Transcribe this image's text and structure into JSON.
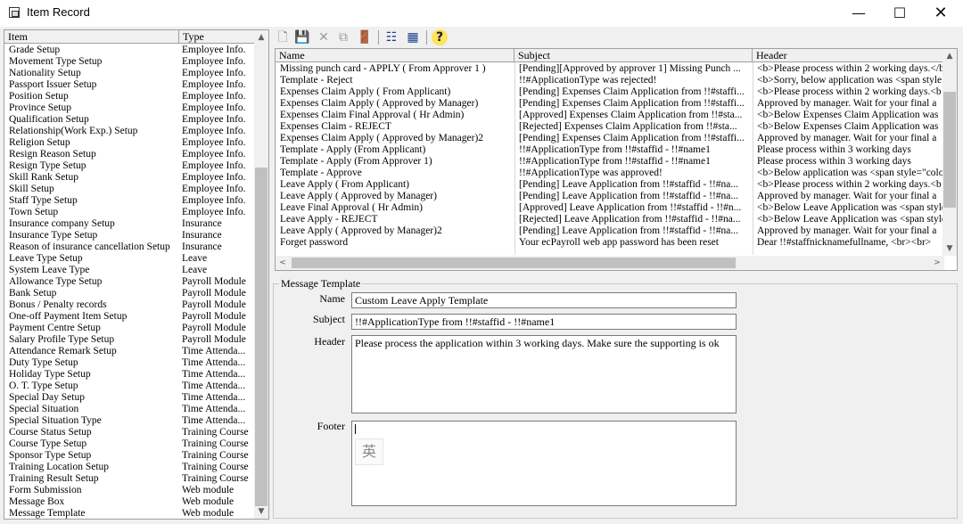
{
  "window": {
    "title": "Item Record",
    "minimize_glyph": "—",
    "maximize_glyph": "☐",
    "close_glyph": "✕"
  },
  "left_list": {
    "columns": [
      "Item",
      "Type"
    ],
    "rows": [
      [
        "Grade Setup",
        "Employee Info."
      ],
      [
        "Movement Type Setup",
        "Employee Info."
      ],
      [
        "Nationality Setup",
        "Employee Info."
      ],
      [
        "Passport Issuer Setup",
        "Employee Info."
      ],
      [
        "Position Setup",
        "Employee Info."
      ],
      [
        "Province Setup",
        "Employee Info."
      ],
      [
        "Qualification Setup",
        "Employee Info."
      ],
      [
        "Relationship(Work Exp.) Setup",
        "Employee Info."
      ],
      [
        "Religion Setup",
        "Employee Info."
      ],
      [
        "Resign Reason Setup",
        "Employee Info."
      ],
      [
        "Resign Type Setup",
        "Employee Info."
      ],
      [
        "Skill Rank Setup",
        "Employee Info."
      ],
      [
        "Skill Setup",
        "Employee Info."
      ],
      [
        "Staff Type Setup",
        "Employee Info."
      ],
      [
        "Town Setup",
        "Employee Info."
      ],
      [
        "Insurance company Setup",
        "Insurance"
      ],
      [
        "Insurance Type Setup",
        "Insurance"
      ],
      [
        "Reason of insurance cancellation Setup",
        "Insurance"
      ],
      [
        "Leave Type Setup",
        "Leave"
      ],
      [
        "System Leave Type",
        "Leave"
      ],
      [
        "Allowance Type Setup",
        "Payroll Module"
      ],
      [
        "Bank Setup",
        "Payroll Module"
      ],
      [
        "Bonus / Penalty records",
        "Payroll Module"
      ],
      [
        "One-off Payment Item Setup",
        "Payroll Module"
      ],
      [
        "Payment Centre Setup",
        "Payroll Module"
      ],
      [
        "Salary Profile Type Setup",
        "Payroll Module"
      ],
      [
        "Attendance Remark Setup",
        "Time Attenda..."
      ],
      [
        "Duty Type Setup",
        "Time Attenda..."
      ],
      [
        "Holiday Type Setup",
        "Time Attenda..."
      ],
      [
        "O. T. Type Setup",
        "Time Attenda..."
      ],
      [
        "Special Day Setup",
        "Time Attenda..."
      ],
      [
        "Special Situation",
        "Time Attenda..."
      ],
      [
        "Special Situation Type",
        "Time Attenda..."
      ],
      [
        "Course Status Setup",
        "Training Course"
      ],
      [
        "Course Type Setup",
        "Training Course"
      ],
      [
        "Sponsor Type Setup",
        "Training Course"
      ],
      [
        "Training Location Setup",
        "Training Course"
      ],
      [
        "Training Result Setup",
        "Training Course"
      ],
      [
        "Form Submission",
        "Web module"
      ],
      [
        "Message Box",
        "Web module"
      ],
      [
        "Message Template",
        "Web module"
      ]
    ],
    "scroll_up": "▲",
    "scroll_down": "▼"
  },
  "toolbar": {
    "new_glyph": "🗋",
    "save_glyph": "💾",
    "delete_glyph": "✕",
    "copy_glyph": "⧉",
    "exit_glyph": "🚪",
    "list_view_glyph": "☷",
    "grid_view_glyph": "▦",
    "help_glyph": "?"
  },
  "templates_grid": {
    "columns": [
      "Name",
      "Subject",
      "Header"
    ],
    "rows": [
      [
        "Missing punch card - APPLY ( From Approver 1 )",
        "[Pending][Approved by approver 1] Missing Punch ...",
        "<b>Please process within 2 working days.</b"
      ],
      [
        "Template - Reject",
        "!!#ApplicationType was rejected!",
        "<b>Sorry, below application was <span style"
      ],
      [
        "Expenses Claim Apply ( From Applicant)",
        "[Pending] Expenses Claim Application from !!#staffi...",
        "<b>Please process within 2 working days.<b"
      ],
      [
        "Expenses Claim Apply ( Approved by Manager)",
        "[Pending] Expenses Claim Application from !!#staffi...",
        "Approved by manager. Wait for your final a"
      ],
      [
        "Expenses Claim Final Approval ( Hr Admin)",
        "[Approved] Expenses Claim Application from !!#sta...",
        "<b>Below Expenses Claim Application was"
      ],
      [
        "Expenses Claim - REJECT",
        "[Rejected] Expenses Claim Application from !!#sta...",
        "<b>Below Expenses Claim Application was"
      ],
      [
        "Expenses Claim Apply ( Approved by Manager)2",
        "[Pending] Expenses Claim Application from !!#staffi...",
        "Approved by manager. Wait for your final a"
      ],
      [
        "Template - Apply (From Applicant)",
        "!!#ApplicationType from !!#staffid - !!#name1",
        "Please process within 3 working days"
      ],
      [
        "Template - Apply (From Approver 1)",
        "!!#ApplicationType from !!#staffid - !!#name1",
        "Please process within 3 working days"
      ],
      [
        "Template - Approve",
        "!!#ApplicationType was approved!",
        "<b>Below application was <span style=\"colo"
      ],
      [
        "Leave Apply ( From Applicant)",
        "[Pending] Leave Application from !!#staffid - !!#na...",
        "<b>Please process within 2 working days.<b"
      ],
      [
        "Leave Apply ( Approved by Manager)",
        "[Pending] Leave Application from !!#staffid - !!#na...",
        "Approved by manager. Wait for your final a"
      ],
      [
        "Leave Final Approval ( Hr Admin)",
        "[Approved] Leave Application from !!#staffid - !!#n...",
        "<b>Below Leave Application was <span style"
      ],
      [
        "Leave Apply - REJECT",
        "[Rejected] Leave Application from !!#staffid - !!#na...",
        "<b>Below Leave Application was <span style"
      ],
      [
        "Leave Apply ( Approved by Manager)2",
        "[Pending] Leave Application from !!#staffid - !!#na...",
        "Approved by manager. Wait for your final a"
      ],
      [
        "Forget password",
        "Your ecPayroll web app password has been reset",
        "Dear !!#staffnicknamefullname,    <br><br>"
      ]
    ],
    "scroll_up": "▲",
    "scroll_down": "▼",
    "scroll_left": "<",
    "scroll_right": ">"
  },
  "message_template": {
    "legend": "Message Template",
    "name_label": "Name",
    "name_value": "Custom Leave Apply Template",
    "subject_label": "Subject",
    "subject_value": "!!#ApplicationType from !!#staffid - !!#name1",
    "header_label": "Header",
    "header_value": "Please process the application within 3 working days. Make sure the supporting is ok",
    "footer_label": "Footer",
    "footer_value": "",
    "ime_indicator": "英"
  }
}
